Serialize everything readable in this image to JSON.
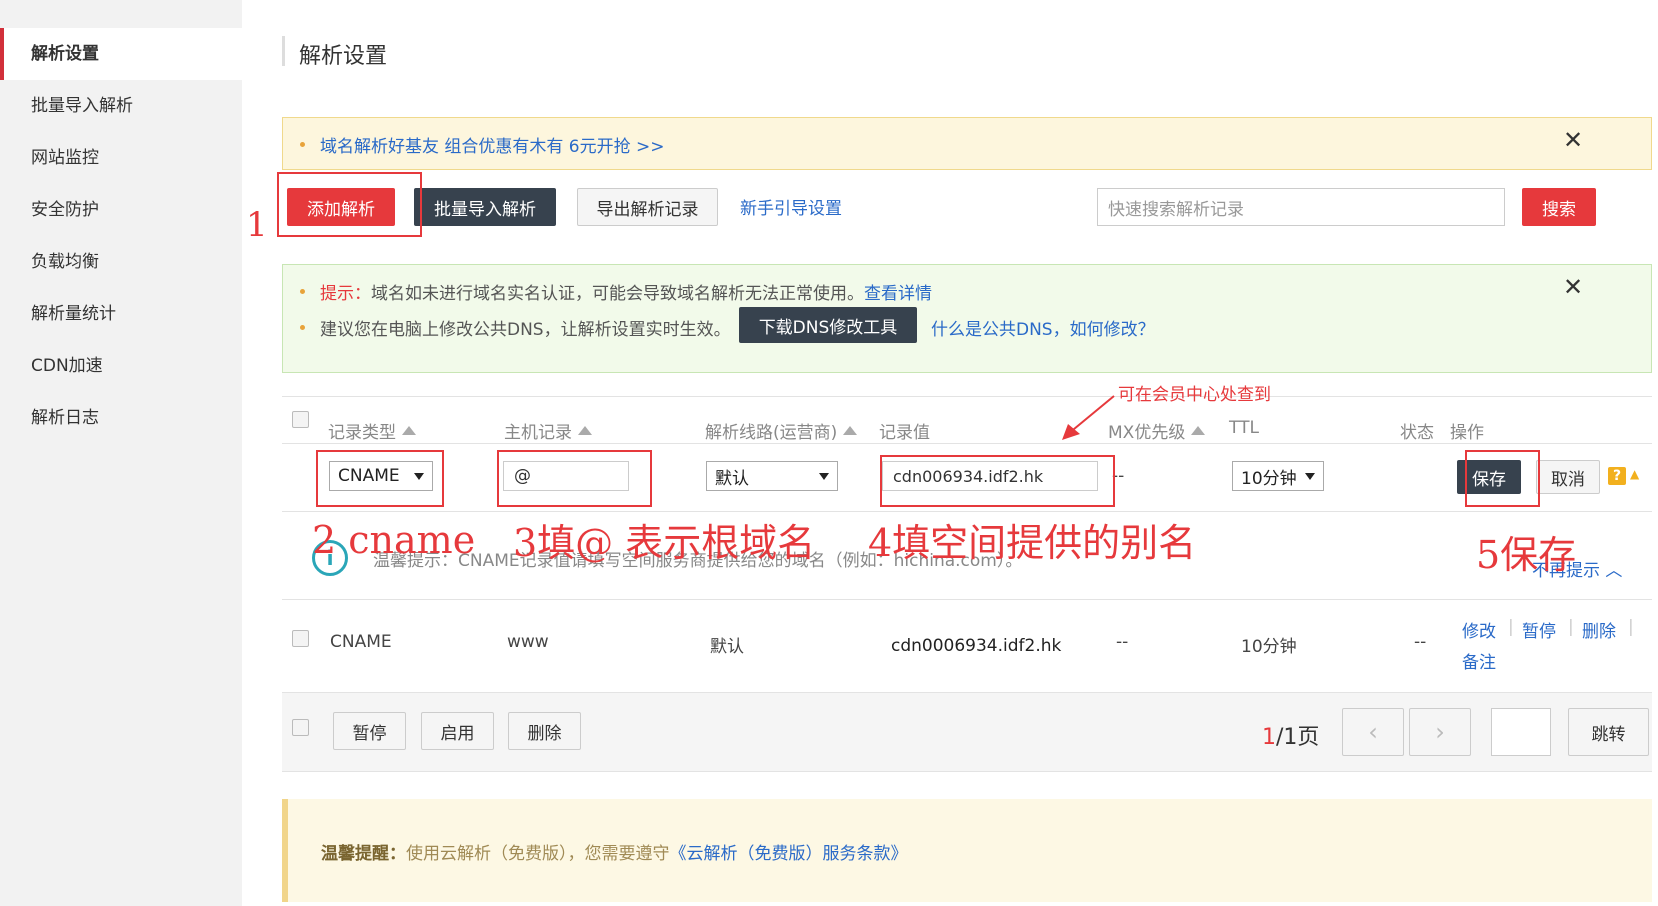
{
  "sidebar": {
    "items": [
      {
        "label": "解析设置",
        "active": true
      },
      {
        "label": "批量导入解析"
      },
      {
        "label": "网站监控"
      },
      {
        "label": "安全防护"
      },
      {
        "label": "负载均衡"
      },
      {
        "label": "解析量统计"
      },
      {
        "label": "CDN加速"
      },
      {
        "label": "解析日志"
      }
    ]
  },
  "page": {
    "title": "解析设置"
  },
  "promo": {
    "text": "域名解析好基友 组合优惠有木有 6元开抢 >>"
  },
  "toolbar": {
    "add": "添加解析",
    "batch_import": "批量导入解析",
    "export": "导出解析记录",
    "guide": "新手引导设置",
    "search_placeholder": "快速搜索解析记录",
    "search": "搜索"
  },
  "tip": {
    "label": "提示：",
    "line1": "域名如未进行域名实名认证，可能会导致域名解析无法正常使用。",
    "details_link": "查看详情",
    "line2": "建议您在电脑上修改公共DNS，让解析设置实时生效。",
    "download_btn": "下载DNS修改工具",
    "dns_link": "什么是公共DNS，如何修改？"
  },
  "table": {
    "headers": {
      "type": "记录类型",
      "host": "主机记录",
      "line": "解析线路(运营商)",
      "value": "记录值",
      "mx": "MX优先级",
      "ttl": "TTL",
      "status": "状态",
      "ops": "操作"
    },
    "edit_row": {
      "type": "CNAME",
      "host": "@",
      "line": "默认",
      "value": "cdn006934.idf2.hk",
      "mx": "--",
      "ttl": "10分钟",
      "save": "保存",
      "cancel": "取消"
    },
    "hint": {
      "text": "温馨提示：CNAME记录值请填写空间服务商提供给您的域名（例如：hichina.com）。",
      "toggle": "不再提示"
    },
    "rows": [
      {
        "type": "CNAME",
        "host": "www",
        "line": "默认",
        "value": "cdn0006934.idf2.hk",
        "mx": "--",
        "ttl": "10分钟",
        "status": "--",
        "ops": [
          "修改",
          "暂停",
          "删除",
          "备注"
        ]
      }
    ]
  },
  "footer": {
    "pause": "暂停",
    "enable": "启用",
    "delete": "删除",
    "page_current": "1",
    "page_total": "/1页",
    "jump": "跳转"
  },
  "notice": {
    "label": "温馨提醒：",
    "text": "使用云解析（免费版），您需要遵守",
    "link": "《云解析（免费版）服务条款》"
  },
  "annotations": {
    "step1": "1",
    "step2": "2 cname",
    "step3": "3填@ 表示根域名",
    "step4": "4填空间提供的别名",
    "step5": "5保存",
    "member_hint": "可在会员中心处查到"
  },
  "colors": {
    "accent": "#e6393c",
    "dark": "#37424e",
    "link": "#2a6ac8"
  }
}
